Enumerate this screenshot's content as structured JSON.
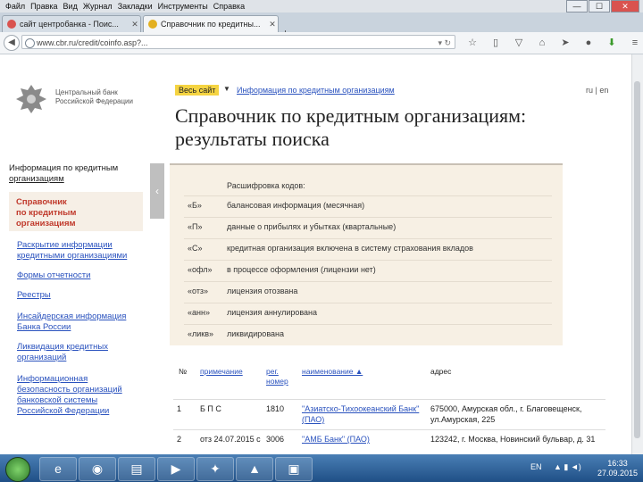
{
  "browser": {
    "menu": [
      "Файл",
      "Правка",
      "Вид",
      "Журнал",
      "Закладки",
      "Инструменты",
      "Справка"
    ],
    "tabs": [
      {
        "label": "сайт центробанка - Поис...",
        "active": false,
        "icon_color": "#d9534f"
      },
      {
        "label": "Справочник по кредитны...",
        "active": true,
        "icon_color": "#e3b020"
      }
    ],
    "new_tab": "+",
    "url": "www.cbr.ru/credit/coinfo.asp?...",
    "window_controls": {
      "minimize": "—",
      "maximize": "☐",
      "close": "✕"
    }
  },
  "site": {
    "bank_name": "Центральный банк Российской Федерации",
    "language_chip": "Весь сайт",
    "breadcrumb": "Информация по кредитным организациям",
    "lang_switch": "ru | en",
    "title": "Справочник по кредитным организациям: результаты поиска"
  },
  "sidebar": {
    "heading": "Информация по кредитным",
    "heading_link": "организациям",
    "active_item_1": "Справочник",
    "active_item_2": "по кредитным",
    "active_item_3": "организациям",
    "items": [
      "Раскрытие информации кредитными организациями",
      "Формы отчетности",
      "Реестры",
      "Инсайдерская информация Банка России",
      "Ликвидация кредитных организаций",
      "Информационная безопасность организаций банковской системы Российской Федерации"
    ]
  },
  "codes": {
    "title": "Расшифровка кодов:",
    "rows": [
      {
        "code": "«Б»",
        "desc": "балансовая информация (месячная)"
      },
      {
        "code": "«П»",
        "desc": "данные о прибылях и убытках (квартальные)"
      },
      {
        "code": "«С»",
        "desc": "кредитная организация включена в систему страхования вкладов"
      },
      {
        "code": "«офл»",
        "desc": "в процессе оформления (лицензии нет)"
      },
      {
        "code": "«отз»",
        "desc": "лицензия отозвана"
      },
      {
        "code": "«анн»",
        "desc": "лицензия аннулирована"
      },
      {
        "code": "«ликв»",
        "desc": "ликвидирована"
      }
    ]
  },
  "table": {
    "headers": {
      "num": "№",
      "note": "примечание",
      "reg": "рег. номер",
      "name": "наименование ▲",
      "addr": "адрес"
    },
    "rows": [
      {
        "num": "1",
        "note": "Б П С",
        "reg": "1810",
        "name": "\"Азиатско-Тихоокеанский Банк\" (ПАО)",
        "addr": "675000, Амурская обл., г. Благовещенск, ул.Амурская, 225"
      },
      {
        "num": "2",
        "note": "отз 24.07.2015 с",
        "reg": "3006",
        "name": "\"АМБ Банк\" (ПАО)",
        "addr": "123242, г. Москва, Новинский бульвар, д. 31"
      }
    ]
  },
  "taskbar": {
    "lang": "EN",
    "time": "16:33",
    "date": "27.09.2015"
  }
}
